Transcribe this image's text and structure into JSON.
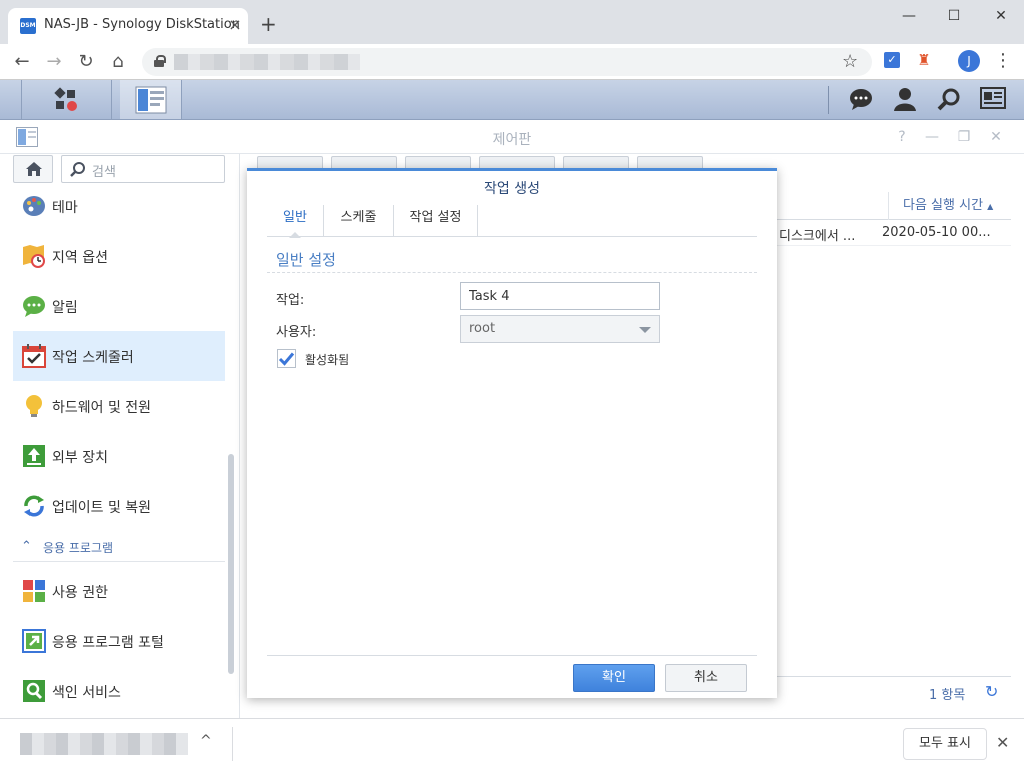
{
  "browser": {
    "tab_title": "NAS-JB - Synology DiskStation",
    "favicon_text": "DSM",
    "tab_close": "×",
    "new_tab": "+",
    "window_controls": {
      "minimize": "—",
      "maximize": "☐",
      "close": "✕"
    },
    "nav": {
      "back": "←",
      "forward": "→",
      "reload": "↻",
      "home": "⌂"
    },
    "bookmark_star": "☆",
    "profile_initial": "J",
    "menu": "⋮",
    "url_visible": false
  },
  "dsm_taskbar": {
    "icons": [
      "main-menu-icon",
      "control-panel-icon"
    ],
    "right_icons": [
      "notification-chat-icon",
      "user-icon",
      "search-icon",
      "widgets-icon"
    ]
  },
  "control_panel": {
    "title": "제어판",
    "window_controls": {
      "help": "?",
      "minimize": "—",
      "restore": "❐",
      "close": "✕"
    },
    "search_placeholder": "검색",
    "sidebar": {
      "items": [
        {
          "label": "테마",
          "icon": "palette-icon"
        },
        {
          "label": "지역 옵션",
          "icon": "map-clock-icon"
        },
        {
          "label": "알림",
          "icon": "chat-bubble-icon"
        },
        {
          "label": "작업 스케줄러",
          "icon": "calendar-check-icon",
          "active": true
        },
        {
          "label": "하드웨어 및 전원",
          "icon": "lightbulb-icon"
        },
        {
          "label": "외부 장치",
          "icon": "upload-device-icon"
        },
        {
          "label": "업데이트 및 복원",
          "icon": "refresh-icon"
        }
      ],
      "group_label": "응용 프로그램",
      "group_items": [
        {
          "label": "사용 권한",
          "icon": "permission-grid-icon"
        },
        {
          "label": "응용 프로그램 포털",
          "icon": "portal-arrow-icon"
        },
        {
          "label": "색인 서비스",
          "icon": "index-search-icon"
        }
      ]
    },
    "grid": {
      "next_run_header": "다음 실행 시간",
      "sort_indicator": "▲",
      "rows": [
        {
          "task_truncated": "디스크에서 ...",
          "next_run": "2020-05-10 00..."
        }
      ],
      "footer_count": "1 항목",
      "refresh": "↻"
    }
  },
  "dialog": {
    "title": "작업 생성",
    "tabs": [
      {
        "label": "일반",
        "active": true
      },
      {
        "label": "스케줄"
      },
      {
        "label": "작업 설정"
      }
    ],
    "section_title": "일반 설정",
    "task_label": "작업:",
    "task_value": "Task 4",
    "user_label": "사용자:",
    "user_value": "root",
    "enabled_label": "활성화됨",
    "enabled_checked": true,
    "ok_label": "확인",
    "cancel_label": "취소"
  },
  "download_bar": {
    "show_all_label": "모두 표시",
    "close": "✕",
    "chevron": "^"
  },
  "colors": {
    "accent": "#3f82dc",
    "dsm_bar": "#b4c3dc",
    "active_item": "#dfeefd",
    "link_blue": "#4a6ea9"
  }
}
